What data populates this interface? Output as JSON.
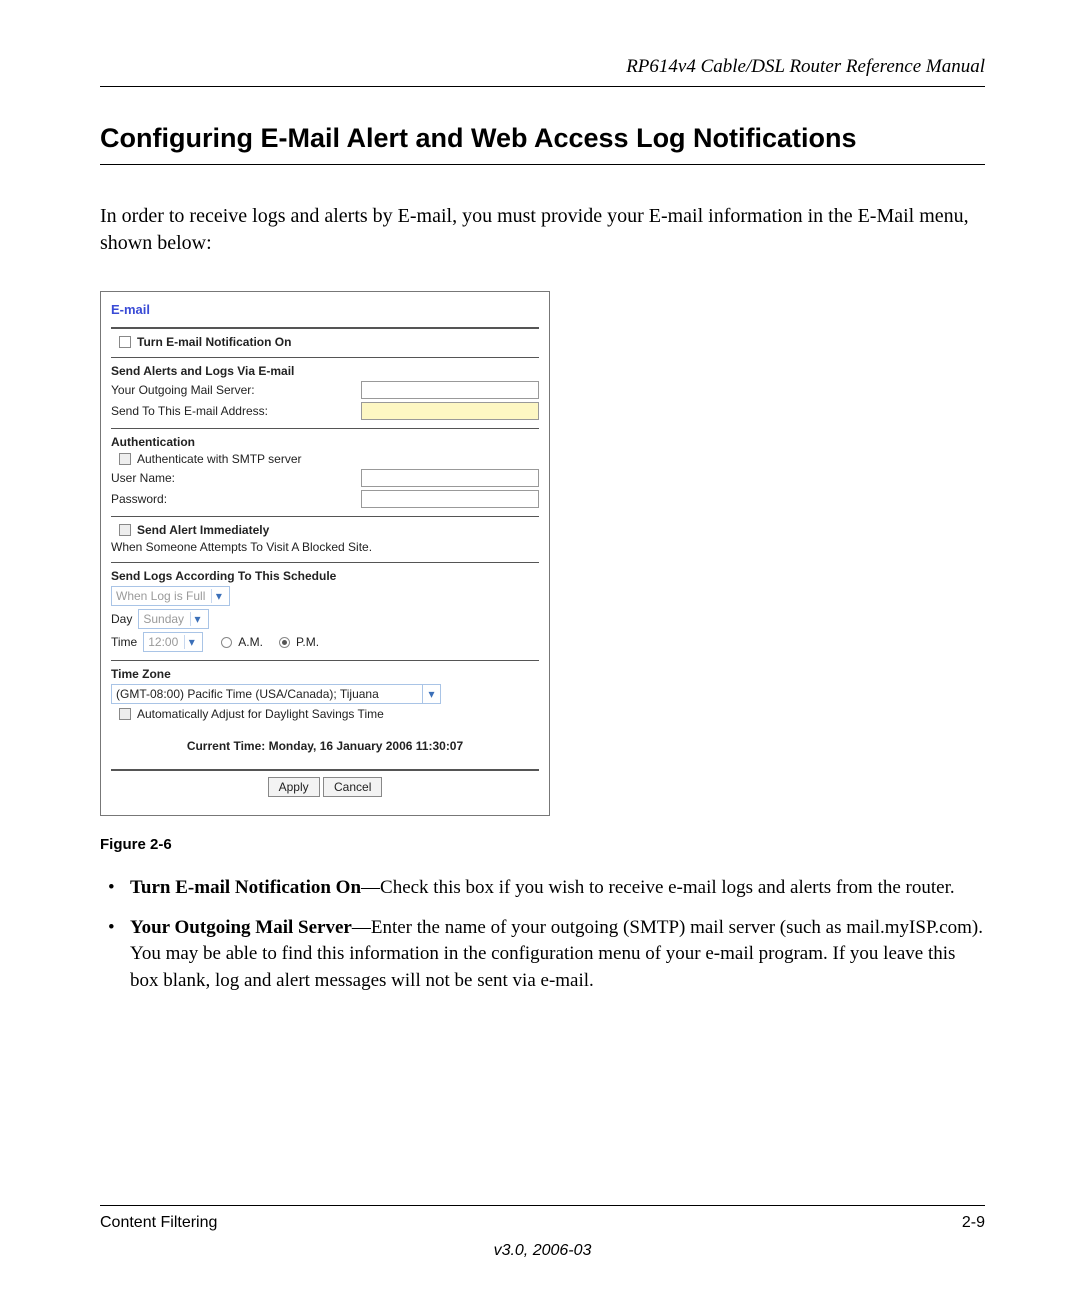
{
  "doc": {
    "header_title": "RP614v4 Cable/DSL Router Reference Manual",
    "section_heading": "Configuring E-Mail Alert and Web Access Log Notifications",
    "intro": "In order to receive logs and alerts by E-mail, you must provide your E-mail information in the E-Mail menu, shown below:",
    "figure_caption": "Figure 2-6",
    "footer": {
      "left": "Content Filtering",
      "right": "2-9",
      "center": "v3.0, 2006-03"
    }
  },
  "panel": {
    "title": "E-mail",
    "turn_on_label": "Turn E-mail Notification On",
    "send_section": {
      "heading": "Send Alerts and Logs Via E-mail",
      "outgoing_label": "Your Outgoing Mail Server:",
      "sendto_label": "Send To This E-mail Address:"
    },
    "auth_section": {
      "heading": "Authentication",
      "auth_checkbox_label": "Authenticate with SMTP server",
      "username_label": "User Name:",
      "password_label": "Password:"
    },
    "alert_section": {
      "checkbox_label": "Send Alert Immediately",
      "desc": "When Someone Attempts To Visit A Blocked Site."
    },
    "schedule_section": {
      "heading": "Send Logs According To This Schedule",
      "when_value": "When Log is Full",
      "day_label": "Day",
      "day_value": "Sunday",
      "time_label": "Time",
      "time_value": "12:00",
      "am_label": "A.M.",
      "pm_label": "P.M."
    },
    "tz_section": {
      "heading": "Time Zone",
      "tz_value": "(GMT-08:00) Pacific Time (USA/Canada); Tijuana",
      "dst_label": "Automatically Adjust for Daylight Savings Time",
      "current_time": "Current Time: Monday, 16 January 2006 11:30:07"
    },
    "buttons": {
      "apply": "Apply",
      "cancel": "Cancel"
    }
  },
  "bullets": {
    "b1_head": "Turn E-mail Notification On",
    "b1_text": "—Check this box if you wish to receive e-mail logs and alerts from the router.",
    "b2_head": "Your Outgoing Mail Server",
    "b2_text": "—Enter the name of your outgoing (SMTP) mail server (such as mail.myISP.com). You may be able to find this information in the configuration menu of your e-mail program. If you leave this box blank, log and alert messages will not be sent via e-mail."
  }
}
